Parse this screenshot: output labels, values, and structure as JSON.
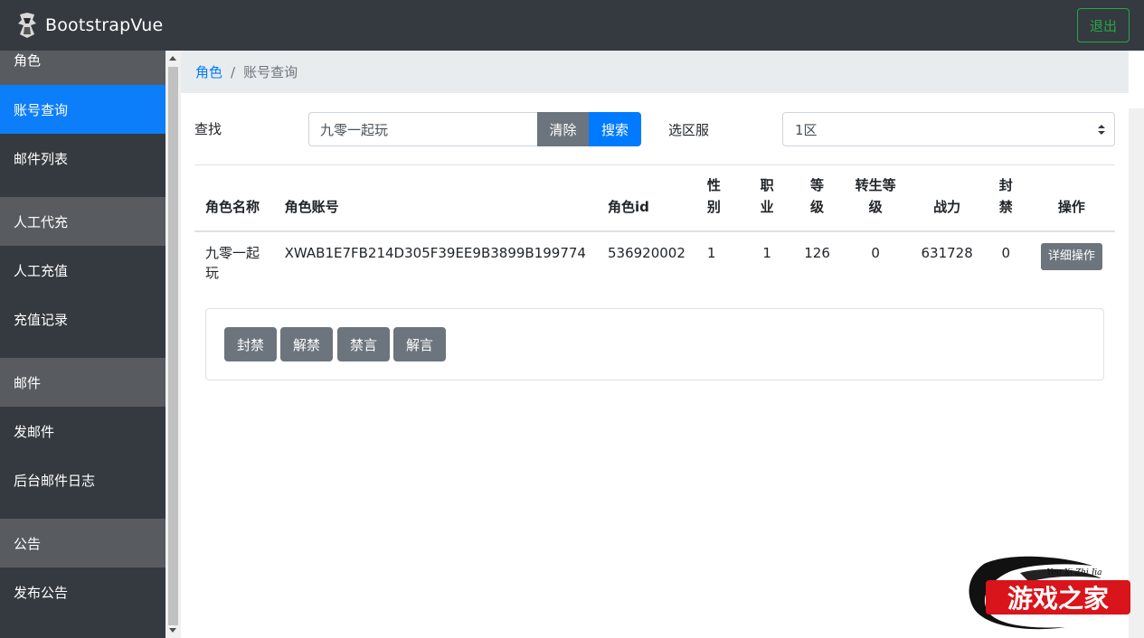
{
  "navbar": {
    "brand": "BootstrapVue",
    "logout_label": "退出"
  },
  "sidebar": {
    "groups": [
      {
        "title": "角色",
        "items": [
          "账号查询",
          "邮件列表"
        ]
      },
      {
        "title": "人工代充",
        "items": [
          "人工充值",
          "充值记录"
        ]
      },
      {
        "title": "邮件",
        "items": [
          "发邮件",
          "后台邮件日志"
        ]
      },
      {
        "title": "公告",
        "items": [
          "发布公告"
        ]
      }
    ],
    "active_item": "账号查询"
  },
  "breadcrumb": {
    "parent": "角色",
    "current": "账号查询"
  },
  "search": {
    "label": "查找",
    "value": "九零一起玩",
    "clear_label": "清除",
    "search_label": "搜索",
    "server_label": "选区服",
    "server_value": "1区"
  },
  "table": {
    "headers": {
      "name": "角色名称",
      "account": "角色账号",
      "id": "角色id",
      "sex_1": "性",
      "sex_2": "别",
      "job_1": "职",
      "job_2": "业",
      "level_1": "等",
      "level_2": "级",
      "rebirth_1": "转生等",
      "rebirth_2": "级",
      "power": "战力",
      "ban_1": "封",
      "ban_2": "禁",
      "op": "操作"
    },
    "row": {
      "name_1": "九零一起",
      "name_2": "玩",
      "account": "XWAB1E7FB214D305F39EE9B3899B199774",
      "id": "536920002",
      "sex": "1",
      "job": "1",
      "level": "126",
      "rebirth": "0",
      "power": "631728",
      "ban": "0",
      "detail_label": "详细操作"
    }
  },
  "actions": {
    "ban": "封禁",
    "unban": "解禁",
    "mute": "禁言",
    "unmute": "解言"
  },
  "watermark": {
    "title": "游戏之家",
    "subtitle": "You Xi Zhi Jia"
  },
  "colors": {
    "navbar": "#343a40",
    "sidebar_group": "#585c61",
    "active": "#0d7ef9",
    "primary": "#007bff",
    "secondary": "#6c757d",
    "success": "#28a745",
    "watermark_red": "#d9141b"
  }
}
